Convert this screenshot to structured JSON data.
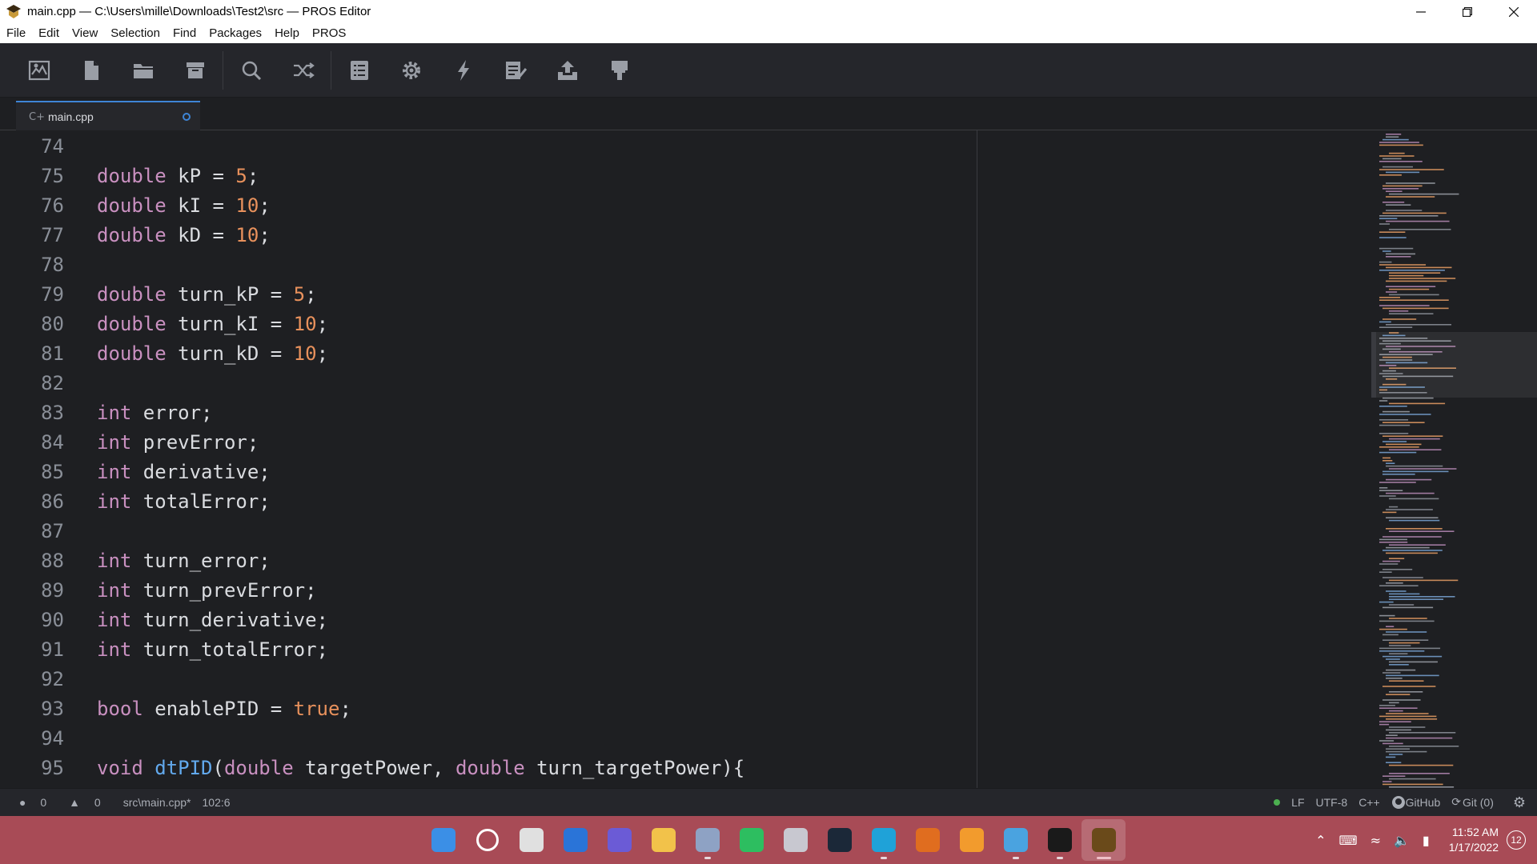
{
  "window": {
    "title": "main.cpp — C:\\Users\\mille\\Downloads\\Test2\\src — PROS Editor"
  },
  "menu": [
    "File",
    "Edit",
    "View",
    "Selection",
    "Find",
    "Packages",
    "Help",
    "PROS"
  ],
  "toolbar": {
    "buttons": [
      "project-icon",
      "new-file-icon",
      "open-folder-icon",
      "archive-icon",
      "search-icon",
      "shuffle-icon",
      "list-icon",
      "settings-gear-icon",
      "lightning-icon",
      "checklist-icon",
      "upload-icon",
      "paint-roller-icon"
    ]
  },
  "tab": {
    "label": "main.cpp",
    "icon": "C+"
  },
  "editor": {
    "lines": [
      {
        "n": "74",
        "tokens": []
      },
      {
        "n": "75",
        "tokens": [
          [
            "kw",
            "double"
          ],
          [
            "t",
            " kP = "
          ],
          [
            "num",
            "5"
          ],
          [
            "t",
            ";"
          ]
        ]
      },
      {
        "n": "76",
        "tokens": [
          [
            "kw",
            "double"
          ],
          [
            "t",
            " kI = "
          ],
          [
            "num",
            "10"
          ],
          [
            "t",
            ";"
          ]
        ]
      },
      {
        "n": "77",
        "tokens": [
          [
            "kw",
            "double"
          ],
          [
            "t",
            " kD = "
          ],
          [
            "num",
            "10"
          ],
          [
            "t",
            ";"
          ]
        ]
      },
      {
        "n": "78",
        "tokens": []
      },
      {
        "n": "79",
        "tokens": [
          [
            "kw",
            "double"
          ],
          [
            "t",
            " turn_kP = "
          ],
          [
            "num",
            "5"
          ],
          [
            "t",
            ";"
          ]
        ]
      },
      {
        "n": "80",
        "tokens": [
          [
            "kw",
            "double"
          ],
          [
            "t",
            " turn_kI = "
          ],
          [
            "num",
            "10"
          ],
          [
            "t",
            ";"
          ]
        ]
      },
      {
        "n": "81",
        "tokens": [
          [
            "kw",
            "double"
          ],
          [
            "t",
            " turn_kD = "
          ],
          [
            "num",
            "10"
          ],
          [
            "t",
            ";"
          ]
        ]
      },
      {
        "n": "82",
        "tokens": []
      },
      {
        "n": "83",
        "tokens": [
          [
            "kw",
            "int"
          ],
          [
            "t",
            " error;"
          ]
        ]
      },
      {
        "n": "84",
        "tokens": [
          [
            "kw",
            "int"
          ],
          [
            "t",
            " prevError;"
          ]
        ]
      },
      {
        "n": "85",
        "tokens": [
          [
            "kw",
            "int"
          ],
          [
            "t",
            " derivative;"
          ]
        ]
      },
      {
        "n": "86",
        "tokens": [
          [
            "kw",
            "int"
          ],
          [
            "t",
            " totalError;"
          ]
        ]
      },
      {
        "n": "87",
        "tokens": []
      },
      {
        "n": "88",
        "tokens": [
          [
            "kw",
            "int"
          ],
          [
            "t",
            " turn_error;"
          ]
        ]
      },
      {
        "n": "89",
        "tokens": [
          [
            "kw",
            "int"
          ],
          [
            "t",
            " turn_prevError;"
          ]
        ]
      },
      {
        "n": "90",
        "tokens": [
          [
            "kw",
            "int"
          ],
          [
            "t",
            " turn_derivative;"
          ]
        ]
      },
      {
        "n": "91",
        "tokens": [
          [
            "kw",
            "int"
          ],
          [
            "t",
            " turn_totalError;"
          ]
        ]
      },
      {
        "n": "92",
        "tokens": []
      },
      {
        "n": "93",
        "tokens": [
          [
            "kw",
            "bool"
          ],
          [
            "t",
            " enablePID = "
          ],
          [
            "bool",
            "true"
          ],
          [
            "t",
            ";"
          ]
        ]
      },
      {
        "n": "94",
        "tokens": []
      },
      {
        "n": "95",
        "tokens": [
          [
            "kw",
            "void"
          ],
          [
            "t",
            " "
          ],
          [
            "fn",
            "dtPID"
          ],
          [
            "t",
            "("
          ],
          [
            "kw",
            "double"
          ],
          [
            "t",
            " targetPower, "
          ],
          [
            "kw",
            "double"
          ],
          [
            "t",
            " turn_targetPower){"
          ]
        ]
      }
    ]
  },
  "status": {
    "errors": "0",
    "warnings": "0",
    "file_path": "src\\main.cpp*",
    "cursor": "102:6",
    "line_ending": "LF",
    "encoding": "UTF-8",
    "grammar": "C++",
    "github": "GitHub",
    "git": "Git (0)"
  },
  "taskbar": {
    "apps": [
      {
        "name": "start-icon",
        "color": "#3b8fe6"
      },
      {
        "name": "search-icon",
        "color": "#ffffff"
      },
      {
        "name": "task-view-icon",
        "color": "#e0e0e0"
      },
      {
        "name": "widgets-icon",
        "color": "#2a74d8"
      },
      {
        "name": "teams-chat-icon",
        "color": "#6b5bd6"
      },
      {
        "name": "file-explorer-icon",
        "color": "#f2c24a"
      },
      {
        "name": "settings-app-icon",
        "color": "#8ea2c4"
      },
      {
        "name": "evernote-icon",
        "color": "#2dbe60"
      },
      {
        "name": "disc-icon",
        "color": "#c8c8d0"
      },
      {
        "name": "steam-icon",
        "color": "#1b2838"
      },
      {
        "name": "edge-icon",
        "color": "#1fa2d8"
      },
      {
        "name": "matlab-icon",
        "color": "#e06d1f"
      },
      {
        "name": "fusion-icon",
        "color": "#f29b2d"
      },
      {
        "name": "notepad-icon",
        "color": "#4aa3e0"
      },
      {
        "name": "stock-chart-icon",
        "color": "#1a1a1a"
      },
      {
        "name": "pros-editor-icon",
        "color": "#6a4a1a"
      }
    ],
    "time": "11:52 AM",
    "date": "1/17/2022",
    "notifications": "12"
  }
}
